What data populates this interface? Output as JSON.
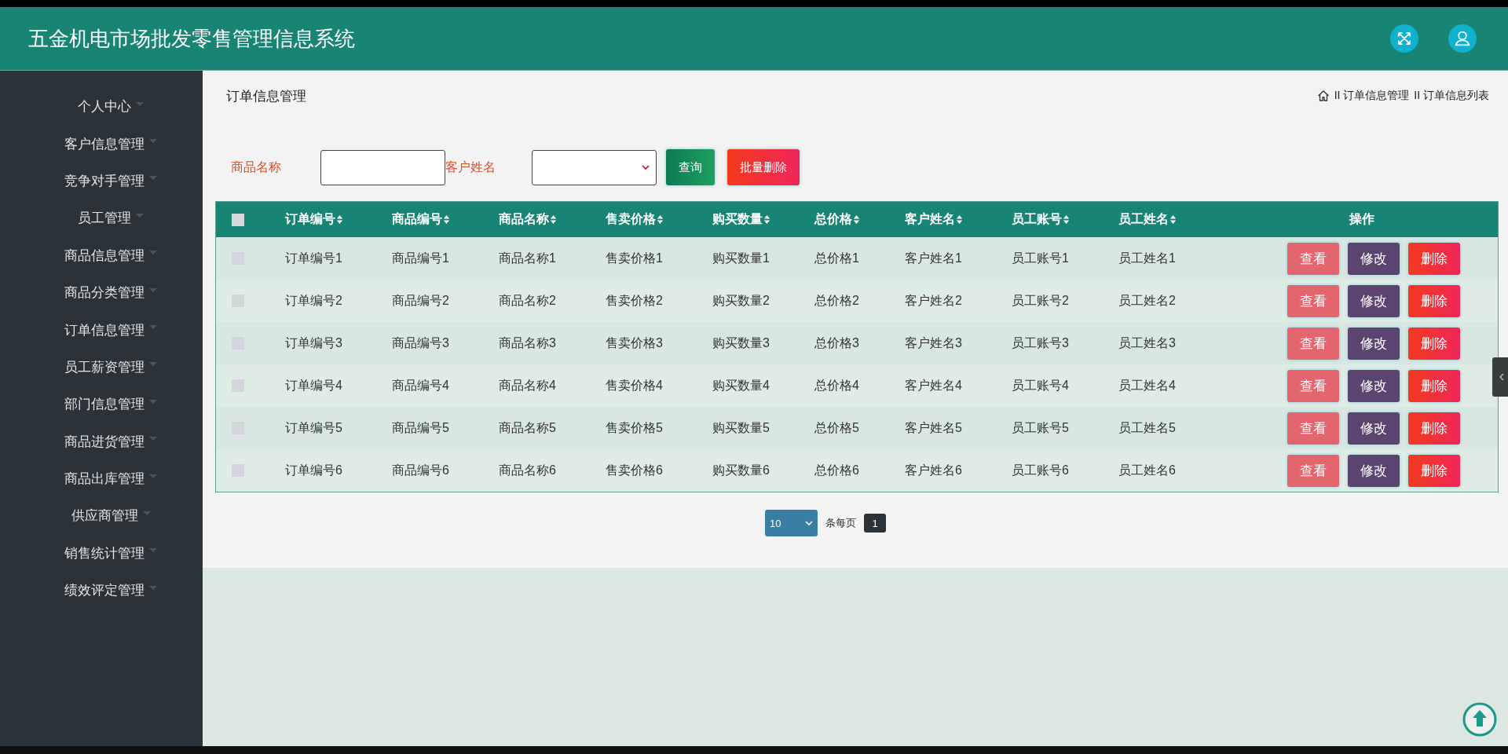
{
  "header": {
    "title": "五金机电市场批发零售管理信息系统"
  },
  "sidebar": {
    "items": [
      {
        "label": "个人中心"
      },
      {
        "label": "客户信息管理"
      },
      {
        "label": "竞争对手管理"
      },
      {
        "label": "员工管理"
      },
      {
        "label": "商品信息管理"
      },
      {
        "label": "商品分类管理"
      },
      {
        "label": "订单信息管理"
      },
      {
        "label": "员工薪资管理"
      },
      {
        "label": "部门信息管理"
      },
      {
        "label": "商品进货管理"
      },
      {
        "label": "商品出库管理"
      },
      {
        "label": "供应商管理"
      },
      {
        "label": "销售统计管理"
      },
      {
        "label": "绩效评定管理"
      }
    ]
  },
  "page": {
    "title": "订单信息管理",
    "breadcrumb": [
      "II 订单信息管理",
      "II 订单信息列表"
    ]
  },
  "search": {
    "fields": [
      {
        "label": "商品名称",
        "kind": "text"
      },
      {
        "label": "客户姓名",
        "kind": "select"
      }
    ],
    "buttons": [
      {
        "label": "查询",
        "kind": "query"
      },
      {
        "label": "批量删除",
        "kind": "delete"
      }
    ]
  },
  "table": {
    "select_all": {
      "checked": false
    },
    "columns": [
      "订单编号",
      "商品编号",
      "商品名称",
      "售卖价格",
      "购买数量",
      "总价格",
      "客户姓名",
      "员工账号",
      "员工姓名"
    ],
    "actions_column": "操作",
    "rows": [
      {
        "checked": false,
        "cells": [
          "订单编号1",
          "商品编号1",
          "商品名称1",
          "售卖价格1",
          "购买数量1",
          "总价格1",
          "客户姓名1",
          "员工账号1",
          "员工姓名1"
        ],
        "actions": [
          {
            "label": "查看",
            "kind": "view"
          },
          {
            "label": "修改",
            "kind": "edit"
          },
          {
            "label": "删除",
            "kind": "delete"
          }
        ]
      },
      {
        "checked": false,
        "cells": [
          "订单编号2",
          "商品编号2",
          "商品名称2",
          "售卖价格2",
          "购买数量2",
          "总价格2",
          "客户姓名2",
          "员工账号2",
          "员工姓名2"
        ],
        "actions": [
          {
            "label": "查看",
            "kind": "view"
          },
          {
            "label": "修改",
            "kind": "edit"
          },
          {
            "label": "删除",
            "kind": "delete"
          }
        ]
      },
      {
        "checked": false,
        "cells": [
          "订单编号3",
          "商品编号3",
          "商品名称3",
          "售卖价格3",
          "购买数量3",
          "总价格3",
          "客户姓名3",
          "员工账号3",
          "员工姓名3"
        ],
        "actions": [
          {
            "label": "查看",
            "kind": "view"
          },
          {
            "label": "修改",
            "kind": "edit"
          },
          {
            "label": "删除",
            "kind": "delete"
          }
        ]
      },
      {
        "checked": false,
        "cells": [
          "订单编号4",
          "商品编号4",
          "商品名称4",
          "售卖价格4",
          "购买数量4",
          "总价格4",
          "客户姓名4",
          "员工账号4",
          "员工姓名4"
        ],
        "actions": [
          {
            "label": "查看",
            "kind": "view"
          },
          {
            "label": "修改",
            "kind": "edit"
          },
          {
            "label": "删除",
            "kind": "delete"
          }
        ]
      },
      {
        "checked": false,
        "cells": [
          "订单编号5",
          "商品编号5",
          "商品名称5",
          "售卖价格5",
          "购买数量5",
          "总价格5",
          "客户姓名5",
          "员工账号5",
          "员工姓名5"
        ],
        "actions": [
          {
            "label": "查看",
            "kind": "view"
          },
          {
            "label": "修改",
            "kind": "edit"
          },
          {
            "label": "删除",
            "kind": "delete"
          }
        ]
      },
      {
        "checked": false,
        "cells": [
          "订单编号6",
          "商品编号6",
          "商品名称6",
          "售卖价格6",
          "购买数量6",
          "总价格6",
          "客户姓名6",
          "员工账号6",
          "员工姓名6"
        ],
        "actions": [
          {
            "label": "查看",
            "kind": "view"
          },
          {
            "label": "修改",
            "kind": "edit"
          },
          {
            "label": "删除",
            "kind": "delete"
          }
        ]
      }
    ]
  },
  "pagination": {
    "page_size": "10",
    "per_page_label": "条每页",
    "pages": [
      {
        "label": "1",
        "selected": true
      }
    ]
  }
}
